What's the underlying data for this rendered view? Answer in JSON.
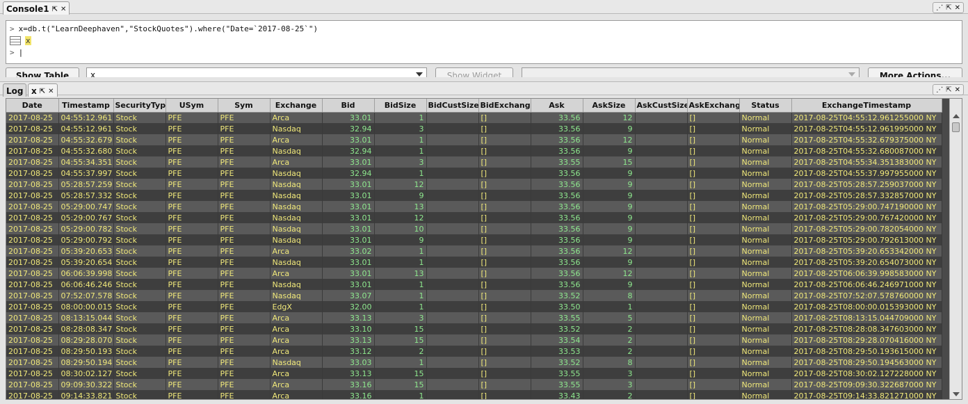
{
  "console_panel": {
    "tab_label": "Console1",
    "lines": [
      {
        "prompt": ">",
        "code": "x=db.t(\"LearnDeephaven\",\"StockQuotes\").where(\"Date=`2017-08-25`\")"
      },
      {
        "prompt": "",
        "code": "x"
      },
      {
        "prompt": ">",
        "code": "|"
      }
    ]
  },
  "controls": {
    "show_table_label": "Show Table",
    "table_select_value": "x",
    "show_widget_label": "Show Widget",
    "widget_select_value": "",
    "more_actions_label": "More Actions..."
  },
  "lower_panel": {
    "tabs": [
      {
        "label": "Log"
      },
      {
        "label": "x"
      }
    ]
  },
  "icons": {
    "tab_float": "float-icon",
    "tab_close": "close-icon",
    "panel_split": "split-icon",
    "panel_maximize": "maximize-icon"
  },
  "colors": {
    "text_cells": "#f0e87a",
    "numeric_cells": "#8ee88e",
    "row_light": "#5a5a5a",
    "row_dark": "#3e3e3e"
  },
  "table": {
    "columns": [
      "Date",
      "Timestamp",
      "SecurityType",
      "USym",
      "Sym",
      "Exchange",
      "Bid",
      "BidSize",
      "BidCustSize",
      "BidExchange",
      "Ask",
      "AskSize",
      "AskCustSize",
      "AskExchange",
      "Status",
      "ExchangeTimestamp"
    ],
    "rows": [
      [
        "2017-08-25",
        "04:55:12.961",
        "Stock",
        "PFE",
        "PFE",
        "Arca",
        "33.01",
        "1",
        "",
        "[]",
        "33.56",
        "12",
        "",
        "[]",
        "Normal",
        "2017-08-25T04:55:12.961255000 NY"
      ],
      [
        "2017-08-25",
        "04:55:12.961",
        "Stock",
        "PFE",
        "PFE",
        "Nasdaq",
        "32.94",
        "3",
        "",
        "[]",
        "33.56",
        "9",
        "",
        "[]",
        "Normal",
        "2017-08-25T04:55:12.961995000 NY"
      ],
      [
        "2017-08-25",
        "04:55:32.679",
        "Stock",
        "PFE",
        "PFE",
        "Arca",
        "33.01",
        "1",
        "",
        "[]",
        "33.56",
        "12",
        "",
        "[]",
        "Normal",
        "2017-08-25T04:55:32.679375000 NY"
      ],
      [
        "2017-08-25",
        "04:55:32.680",
        "Stock",
        "PFE",
        "PFE",
        "Nasdaq",
        "32.94",
        "1",
        "",
        "[]",
        "33.56",
        "9",
        "",
        "[]",
        "Normal",
        "2017-08-25T04:55:32.680087000 NY"
      ],
      [
        "2017-08-25",
        "04:55:34.351",
        "Stock",
        "PFE",
        "PFE",
        "Arca",
        "33.01",
        "3",
        "",
        "[]",
        "33.55",
        "15",
        "",
        "[]",
        "Normal",
        "2017-08-25T04:55:34.351383000 NY"
      ],
      [
        "2017-08-25",
        "04:55:37.997",
        "Stock",
        "PFE",
        "PFE",
        "Nasdaq",
        "32.94",
        "1",
        "",
        "[]",
        "33.56",
        "9",
        "",
        "[]",
        "Normal",
        "2017-08-25T04:55:37.997955000 NY"
      ],
      [
        "2017-08-25",
        "05:28:57.259",
        "Stock",
        "PFE",
        "PFE",
        "Nasdaq",
        "33.01",
        "12",
        "",
        "[]",
        "33.56",
        "9",
        "",
        "[]",
        "Normal",
        "2017-08-25T05:28:57.259037000 NY"
      ],
      [
        "2017-08-25",
        "05:28:57.332",
        "Stock",
        "PFE",
        "PFE",
        "Nasdaq",
        "33.01",
        "9",
        "",
        "[]",
        "33.56",
        "9",
        "",
        "[]",
        "Normal",
        "2017-08-25T05:28:57.332857000 NY"
      ],
      [
        "2017-08-25",
        "05:29:00.747",
        "Stock",
        "PFE",
        "PFE",
        "Nasdaq",
        "33.01",
        "13",
        "",
        "[]",
        "33.56",
        "9",
        "",
        "[]",
        "Normal",
        "2017-08-25T05:29:00.747190000 NY"
      ],
      [
        "2017-08-25",
        "05:29:00.767",
        "Stock",
        "PFE",
        "PFE",
        "Nasdaq",
        "33.01",
        "12",
        "",
        "[]",
        "33.56",
        "9",
        "",
        "[]",
        "Normal",
        "2017-08-25T05:29:00.767420000 NY"
      ],
      [
        "2017-08-25",
        "05:29:00.782",
        "Stock",
        "PFE",
        "PFE",
        "Nasdaq",
        "33.01",
        "10",
        "",
        "[]",
        "33.56",
        "9",
        "",
        "[]",
        "Normal",
        "2017-08-25T05:29:00.782054000 NY"
      ],
      [
        "2017-08-25",
        "05:29:00.792",
        "Stock",
        "PFE",
        "PFE",
        "Nasdaq",
        "33.01",
        "9",
        "",
        "[]",
        "33.56",
        "9",
        "",
        "[]",
        "Normal",
        "2017-08-25T05:29:00.792613000 NY"
      ],
      [
        "2017-08-25",
        "05:39:20.653",
        "Stock",
        "PFE",
        "PFE",
        "Arca",
        "33.02",
        "1",
        "",
        "[]",
        "33.56",
        "12",
        "",
        "[]",
        "Normal",
        "2017-08-25T05:39:20.653342000 NY"
      ],
      [
        "2017-08-25",
        "05:39:20.654",
        "Stock",
        "PFE",
        "PFE",
        "Nasdaq",
        "33.01",
        "1",
        "",
        "[]",
        "33.56",
        "9",
        "",
        "[]",
        "Normal",
        "2017-08-25T05:39:20.654073000 NY"
      ],
      [
        "2017-08-25",
        "06:06:39.998",
        "Stock",
        "PFE",
        "PFE",
        "Arca",
        "33.01",
        "13",
        "",
        "[]",
        "33.56",
        "12",
        "",
        "[]",
        "Normal",
        "2017-08-25T06:06:39.998583000 NY"
      ],
      [
        "2017-08-25",
        "06:06:46.246",
        "Stock",
        "PFE",
        "PFE",
        "Nasdaq",
        "33.01",
        "1",
        "",
        "[]",
        "33.56",
        "9",
        "",
        "[]",
        "Normal",
        "2017-08-25T06:06:46.246971000 NY"
      ],
      [
        "2017-08-25",
        "07:52:07.578",
        "Stock",
        "PFE",
        "PFE",
        "Nasdaq",
        "33.07",
        "1",
        "",
        "[]",
        "33.52",
        "8",
        "",
        "[]",
        "Normal",
        "2017-08-25T07:52:07.578760000 NY"
      ],
      [
        "2017-08-25",
        "08:00:00.015",
        "Stock",
        "PFE",
        "PFE",
        "EdgX",
        "32.00",
        "1",
        "",
        "[]",
        "33.50",
        "1",
        "",
        "[]",
        "Normal",
        "2017-08-25T08:00:00.015393000 NY"
      ],
      [
        "2017-08-25",
        "08:13:15.044",
        "Stock",
        "PFE",
        "PFE",
        "Arca",
        "33.13",
        "3",
        "",
        "[]",
        "33.55",
        "5",
        "",
        "[]",
        "Normal",
        "2017-08-25T08:13:15.044709000 NY"
      ],
      [
        "2017-08-25",
        "08:28:08.347",
        "Stock",
        "PFE",
        "PFE",
        "Arca",
        "33.10",
        "15",
        "",
        "[]",
        "33.52",
        "2",
        "",
        "[]",
        "Normal",
        "2017-08-25T08:28:08.347603000 NY"
      ],
      [
        "2017-08-25",
        "08:29:28.070",
        "Stock",
        "PFE",
        "PFE",
        "Arca",
        "33.13",
        "15",
        "",
        "[]",
        "33.54",
        "2",
        "",
        "[]",
        "Normal",
        "2017-08-25T08:29:28.070416000 NY"
      ],
      [
        "2017-08-25",
        "08:29:50.193",
        "Stock",
        "PFE",
        "PFE",
        "Arca",
        "33.12",
        "2",
        "",
        "[]",
        "33.53",
        "2",
        "",
        "[]",
        "Normal",
        "2017-08-25T08:29:50.193615000 NY"
      ],
      [
        "2017-08-25",
        "08:29:50.194",
        "Stock",
        "PFE",
        "PFE",
        "Nasdaq",
        "33.03",
        "1",
        "",
        "[]",
        "33.52",
        "8",
        "",
        "[]",
        "Normal",
        "2017-08-25T08:29:50.194563000 NY"
      ],
      [
        "2017-08-25",
        "08:30:02.127",
        "Stock",
        "PFE",
        "PFE",
        "Arca",
        "33.13",
        "15",
        "",
        "[]",
        "33.55",
        "3",
        "",
        "[]",
        "Normal",
        "2017-08-25T08:30:02.127228000 NY"
      ],
      [
        "2017-08-25",
        "09:09:30.322",
        "Stock",
        "PFE",
        "PFE",
        "Arca",
        "33.16",
        "15",
        "",
        "[]",
        "33.55",
        "3",
        "",
        "[]",
        "Normal",
        "2017-08-25T09:09:30.322687000 NY"
      ],
      [
        "2017-08-25",
        "09:14:33.821",
        "Stock",
        "PFE",
        "PFE",
        "Arca",
        "33.16",
        "1",
        "",
        "[]",
        "33.43",
        "2",
        "",
        "[]",
        "Normal",
        "2017-08-25T09:14:33.821271000 NY"
      ]
    ]
  }
}
